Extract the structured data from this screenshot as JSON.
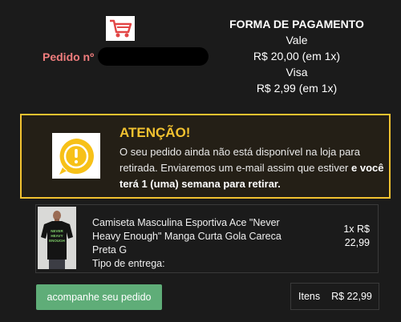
{
  "order": {
    "label": "Pedido nº"
  },
  "payment": {
    "title": "FORMA DE PAGAMENTO",
    "methods": [
      {
        "name": "Vale",
        "amount": "R$ 20,00 (em 1x)"
      },
      {
        "name": "Visa",
        "amount": "R$ 2,99 (em 1x)"
      }
    ]
  },
  "alert": {
    "title": "ATENÇÃO!",
    "text_plain": "O seu pedido ainda não está disponível na loja para retirada. Enviaremos um e-mail assim que estiver",
    "text_bold": "e você terá 1 (uma) semana para retirar.",
    "icon": "exclamation-icon",
    "accent_color": "#f2c230"
  },
  "product": {
    "name": "Camiseta Masculina Esportiva Ace \"Never Heavy Enough\" Manga Curta Gola Careca Preta G",
    "delivery_label": "Tipo de entrega:",
    "qty_price": "1x R$ 22,99",
    "shirt_print": [
      "NEVER",
      "HEAVY",
      "ENOUGH"
    ]
  },
  "actions": {
    "track_label": "acompanhe seu pedido",
    "track_color": "#5fad78"
  },
  "totals": {
    "label": "Itens",
    "value": "R$ 22,99"
  }
}
